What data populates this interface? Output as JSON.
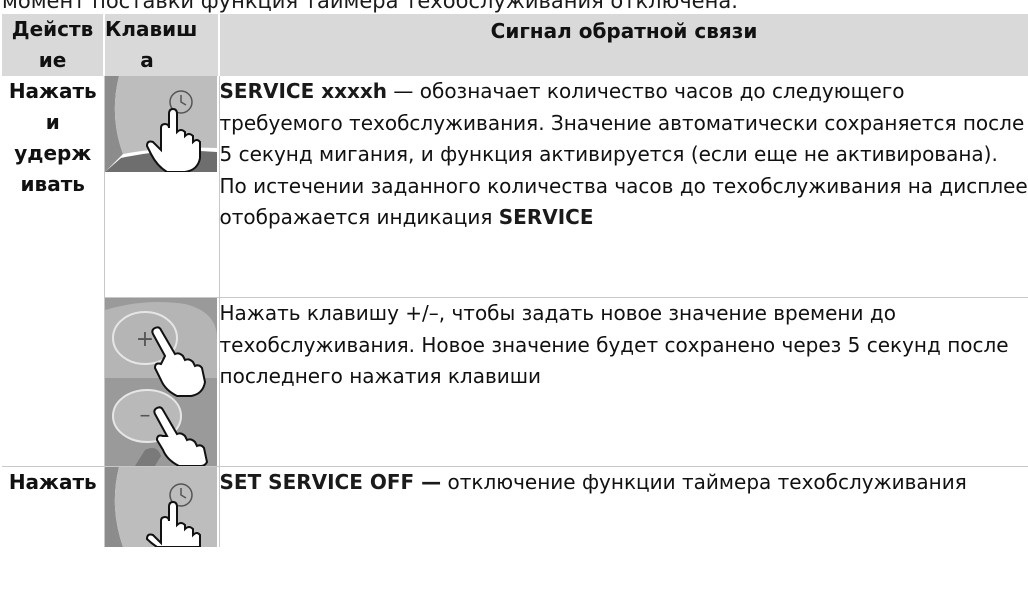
{
  "intro_text": "момент поставки функция таймера техобслуживания отключена.",
  "table": {
    "headers": {
      "action_line1": "Действ",
      "action_line2": "ие",
      "key_line1": "Клавиш",
      "key_line2": "а",
      "signal": "Сигнал обратной связи"
    },
    "rows": [
      {
        "action_lines": [
          "Нажать",
          "и",
          "удерж",
          "ивать"
        ],
        "key_icon": "clock-key-press-icon",
        "signal_bold_start": "SERVICE xxxxh",
        "signal_text": " — обозначает количество часов до следующего требуемого техобслуживания. Значение автоматически сохраняется после 5 секунд мигания, и функция активируется (если еще не активирована). По истечении заданного количества часов до техобслуживания на дисплее отображается индикация ",
        "signal_bold_end": "SERVICE"
      },
      {
        "key_icon": "plus-minus-keys-press-icon",
        "signal_text": "Нажать клавишу +/–, чтобы задать новое значение времени до техобслуживания. Новое значение будет сохранено через 5 секунд после последнего нажатия клавиши"
      },
      {
        "action_lines": [
          "Нажать"
        ],
        "key_icon": "clock-key-press-icon",
        "signal_bold_start": "SET SERVICE OFF —",
        "signal_text": " отключение функции таймера техобслуживания"
      }
    ]
  },
  "colors": {
    "header_bg": "#d9d9d9",
    "panel_grey": "#8c8c8c",
    "panel_light": "#bdbdbd",
    "grid_line": "#c8c8c8"
  }
}
